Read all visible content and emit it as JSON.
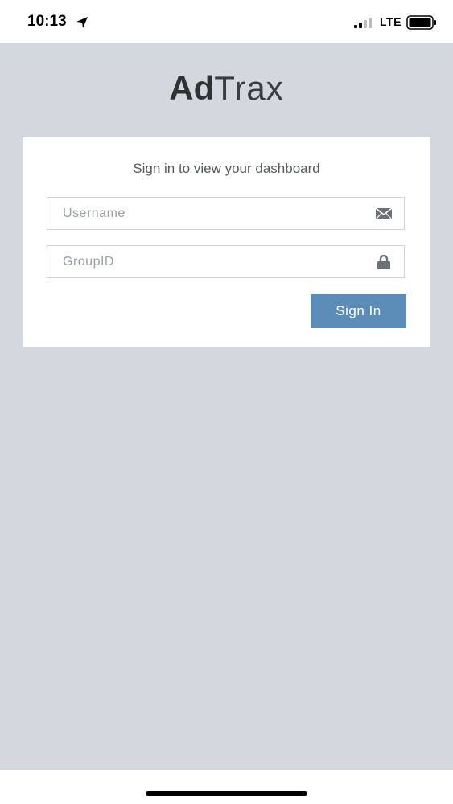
{
  "status_bar": {
    "time": "10:13",
    "network": "LTE",
    "location_icon": "location-arrow-icon",
    "signal_icon": "cellular-signal-icon",
    "battery_icon": "battery-icon"
  },
  "logo": {
    "bold_part": "Ad",
    "light_part": "Trax"
  },
  "login": {
    "title": "Sign in to view your dashboard",
    "username_placeholder": "Username",
    "username_value": "",
    "username_icon": "envelope-icon",
    "groupid_placeholder": "GroupID",
    "groupid_value": "",
    "groupid_icon": "lock-icon",
    "signin_label": "Sign In"
  },
  "colors": {
    "background": "#d4d7de",
    "card": "#ffffff",
    "button": "#5b8db8",
    "logo_text": "#2f3133"
  }
}
